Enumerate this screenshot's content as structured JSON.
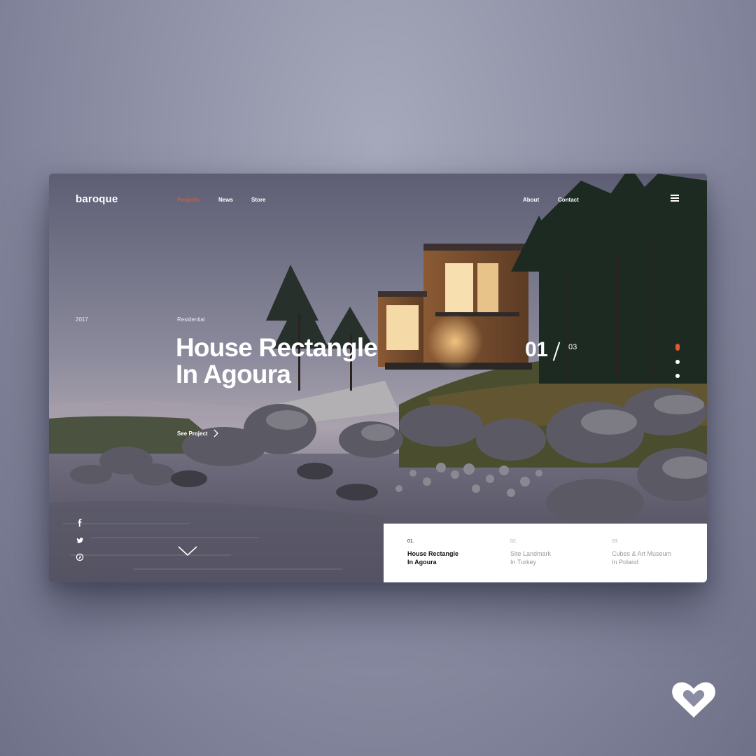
{
  "brand": "baroque",
  "nav": {
    "left": [
      {
        "label": "Projects",
        "active": true
      },
      {
        "label": "News",
        "active": false
      },
      {
        "label": "Store",
        "active": false
      }
    ],
    "right": [
      {
        "label": "About"
      },
      {
        "label": "Contact"
      }
    ],
    "menu_icon": "hamburger-icon"
  },
  "hero": {
    "year": "2017",
    "category": "Residential",
    "title": "House Rectangle\nIn Agoura",
    "cta": "See Project",
    "cta_icon": "chevron-right-icon",
    "scroll_icon": "chevron-down-icon"
  },
  "counter": {
    "current": "01",
    "total": "03"
  },
  "slider": {
    "slides": 3,
    "active_index": 0
  },
  "social": [
    {
      "icon": "facebook-icon"
    },
    {
      "icon": "twitter-icon"
    },
    {
      "icon": "pinterest-icon"
    }
  ],
  "projects": [
    {
      "num": "01.",
      "title": "House Rectangle\nIn Agoura",
      "active": true
    },
    {
      "num": "02.",
      "title": "Site Landmark\nIn Turkey",
      "active": false
    },
    {
      "num": "03.",
      "title": "Cubes & Art Museum\nIn Poland",
      "active": false
    }
  ],
  "colors": {
    "accent": "#e0582d",
    "background": "#8e91a6",
    "panel": "#ffffff",
    "text_light": "#ffffff",
    "text_dark": "#111111"
  },
  "badge_icon": "heart-icon"
}
